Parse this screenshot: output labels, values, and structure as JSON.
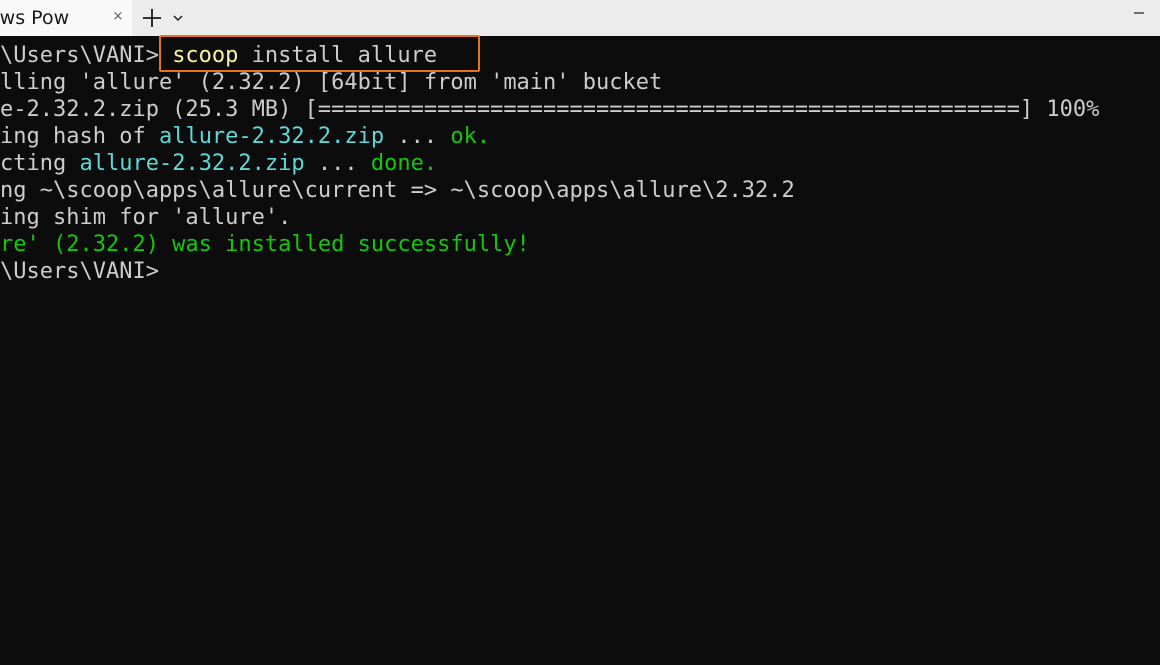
{
  "tab": {
    "title": "dows Pow",
    "close_glyph": "×",
    "new_tab_icon": "plus-icon",
    "dropdown_icon": "chevron-down-icon"
  },
  "window_controls": {
    "minimize_glyph": "–"
  },
  "terminal": {
    "lines": [
      {
        "segments": [
          {
            "text": "\\Users\\VANI> ",
            "color": "gray"
          },
          {
            "text": "scoop",
            "color": "yellow"
          },
          {
            "text": " install allure",
            "color": "gray"
          }
        ]
      },
      {
        "segments": [
          {
            "text": "lling 'allure' (2.32.2) [64bit] from 'main' bucket",
            "color": "gray"
          }
        ]
      },
      {
        "segments": [
          {
            "text": "e-2.32.2.zip (25.3 MB) [=====================================================] 100%",
            "color": "gray"
          }
        ]
      },
      {
        "segments": [
          {
            "text": "ing hash of ",
            "color": "gray"
          },
          {
            "text": "allure-2.32.2.zip",
            "color": "cyan"
          },
          {
            "text": " ... ",
            "color": "gray"
          },
          {
            "text": "ok.",
            "color": "green"
          }
        ]
      },
      {
        "segments": [
          {
            "text": "cting ",
            "color": "gray"
          },
          {
            "text": "allure-2.32.2.zip",
            "color": "cyan"
          },
          {
            "text": " ... ",
            "color": "gray"
          },
          {
            "text": "done.",
            "color": "green"
          }
        ]
      },
      {
        "segments": [
          {
            "text": "ng ~\\scoop\\apps\\allure\\current => ~\\scoop\\apps\\allure\\2.32.2",
            "color": "gray"
          }
        ]
      },
      {
        "segments": [
          {
            "text": "ing shim for 'allure'.",
            "color": "gray"
          }
        ]
      },
      {
        "segments": [
          {
            "text": "re' (2.32.2) was installed successfully!",
            "color": "green"
          }
        ]
      },
      {
        "segments": [
          {
            "text": "\\Users\\VANI>",
            "color": "gray"
          }
        ]
      }
    ]
  },
  "colors": {
    "background": "#0c0c0c",
    "foreground": "#cccccc",
    "yellow": "#f9f1a5",
    "cyan": "#61d6d6",
    "green": "#16c60c",
    "highlight_border": "#e8731a",
    "titlebar": "#ececec",
    "tab": "#f9f9f9"
  }
}
